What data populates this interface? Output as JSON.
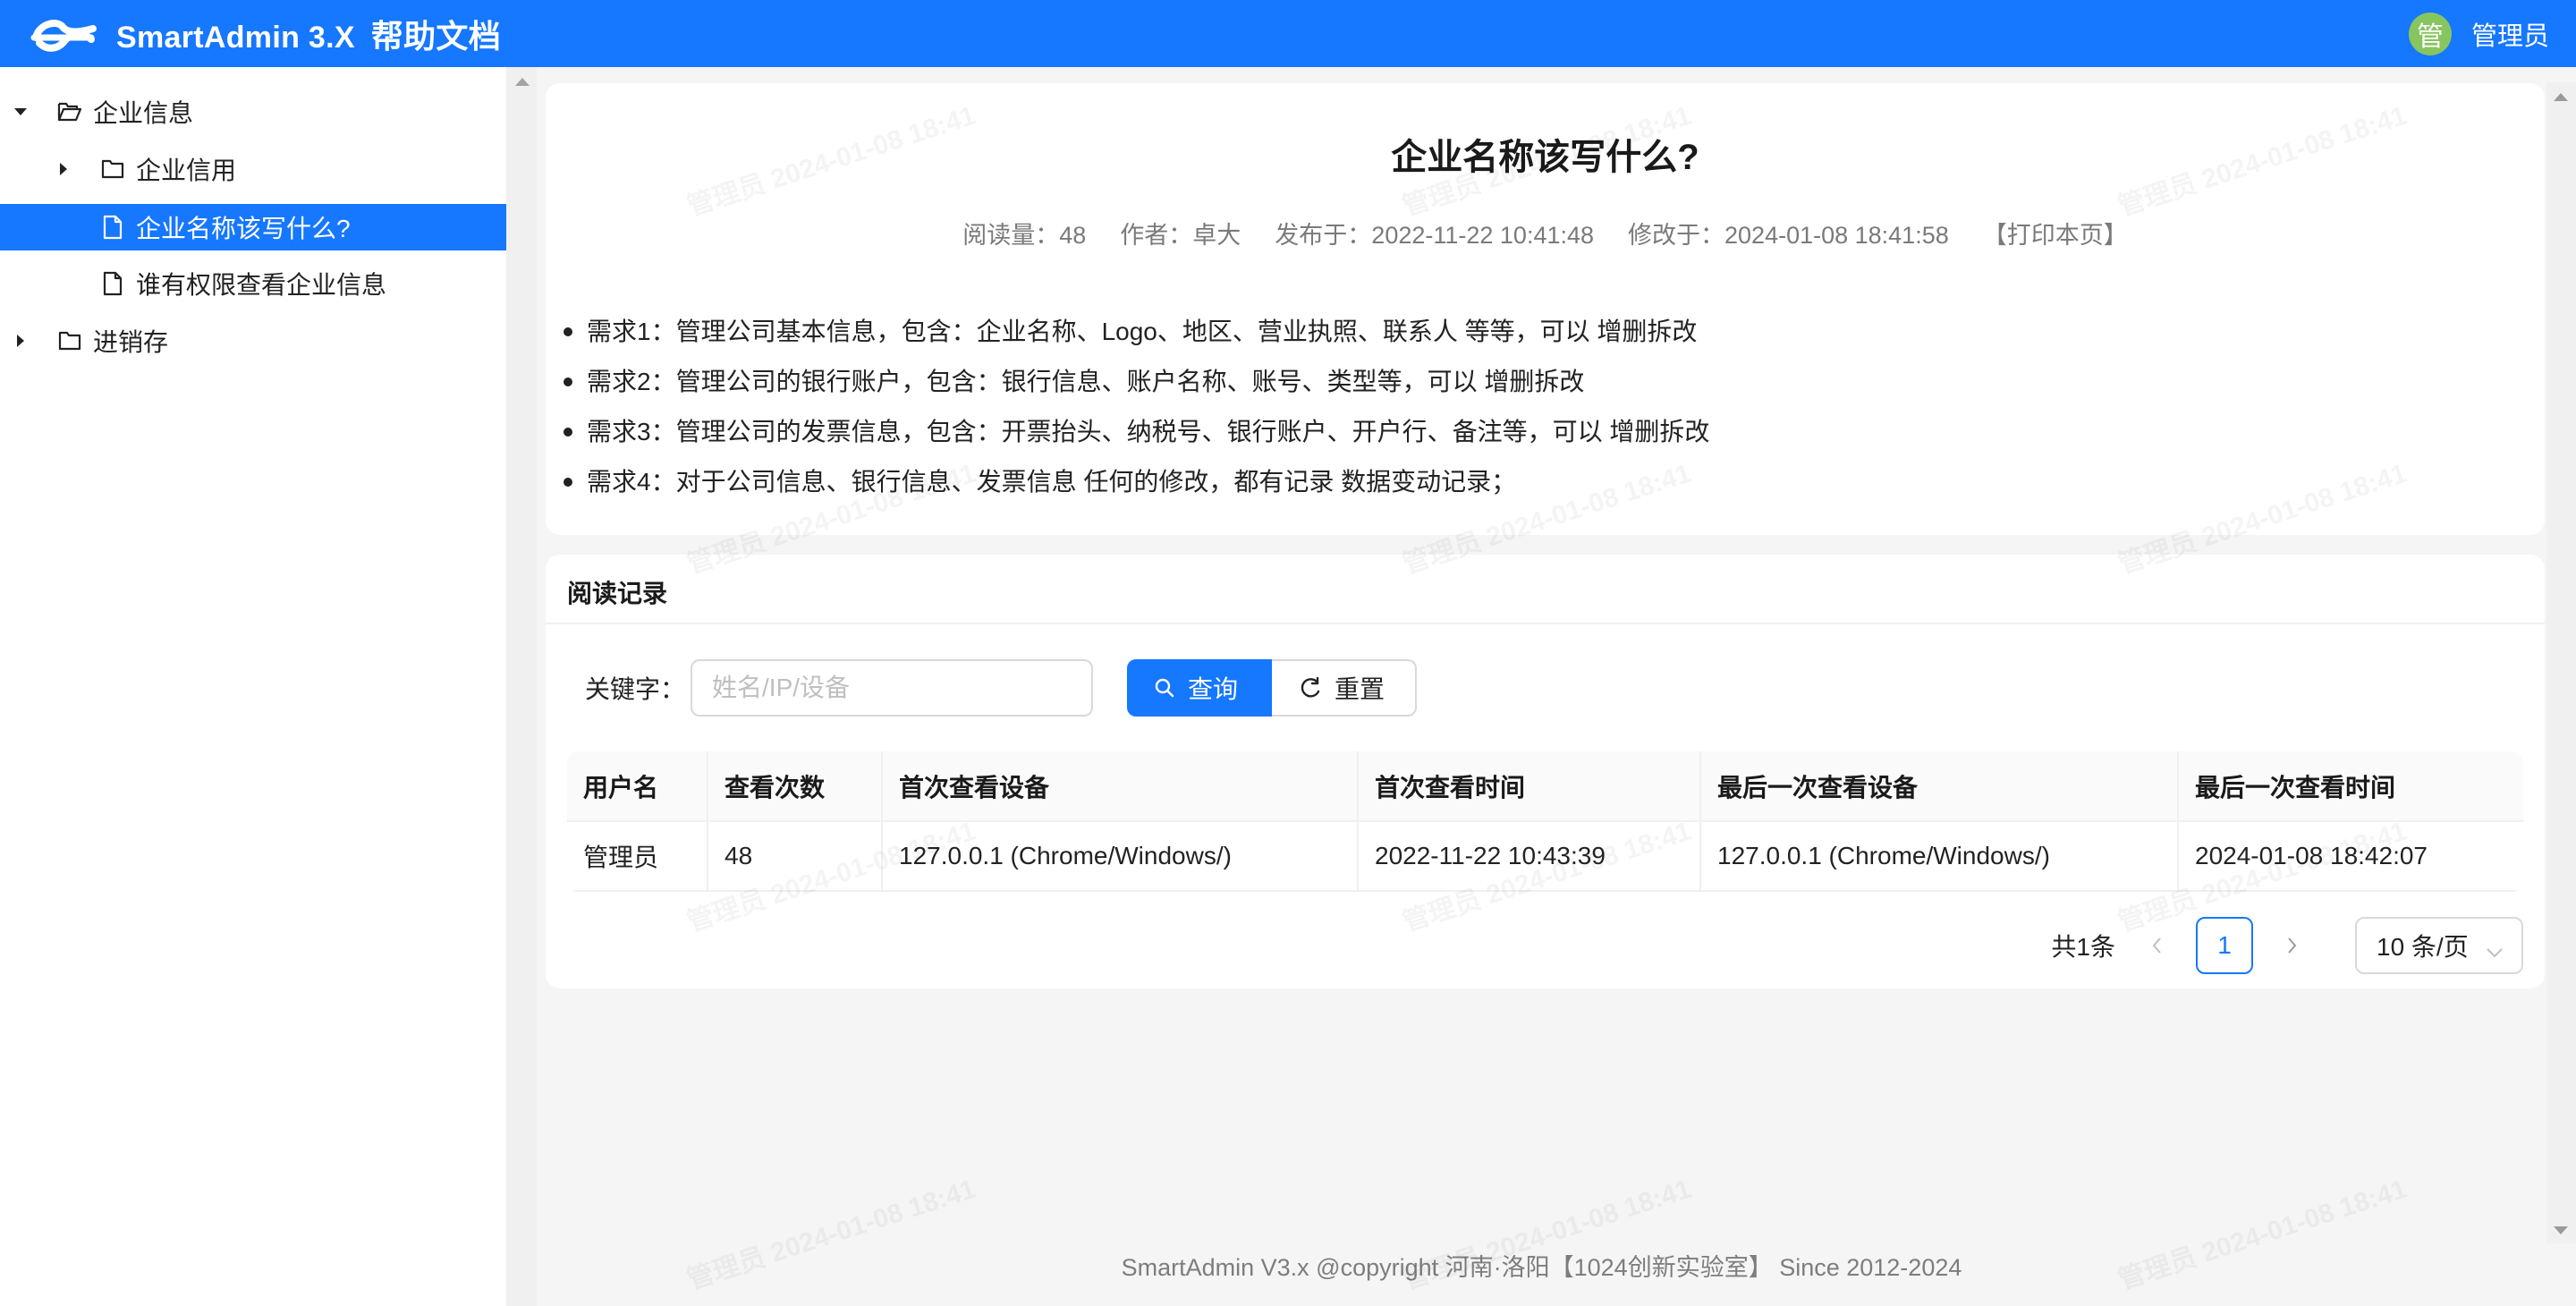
{
  "header": {
    "app_name": "SmartAdmin 3.X",
    "app_subtitle": "帮助文档",
    "avatar_char": "管",
    "user_name": "管理员",
    "brand_color": "#1677ff",
    "avatar_color": "#87c55f"
  },
  "sidebar": {
    "nodes": [
      {
        "label": "企业信息",
        "level": 0,
        "type": "folder",
        "expanded": true,
        "icon": "folder-open-icon"
      },
      {
        "label": "企业信用",
        "level": 1,
        "type": "folder",
        "expanded": false,
        "icon": "folder-icon"
      },
      {
        "label": "企业名称该写什么?",
        "level": 2,
        "type": "file",
        "selected": true,
        "icon": "file-icon"
      },
      {
        "label": "谁有权限查看企业信息",
        "level": 2,
        "type": "file",
        "icon": "file-icon"
      },
      {
        "label": "进销存",
        "level": 0,
        "type": "folder",
        "expanded": false,
        "icon": "folder-icon"
      }
    ]
  },
  "doc": {
    "title": "企业名称该写什么?",
    "meta": {
      "views": "阅读量：48",
      "author": "作者：卓大",
      "published": "发布于：2022-11-22 10:41:48",
      "modified": "修改于：2024-01-08 18:41:58",
      "print": "【打印本页】"
    },
    "items": [
      "需求1：管理公司基本信息，包含：企业名称、Logo、地区、营业执照、联系人 等等，可以 增删拆改",
      "需求2：管理公司的银行账户，包含：银行信息、账户名称、账号、类型等，可以 增删拆改",
      "需求3：管理公司的发票信息，包含：开票抬头、纳税号、银行账户、开户行、备注等，可以 增删拆改",
      "需求4：对于公司信息、银行信息、发票信息 任何的修改，都有记录 数据变动记录；"
    ]
  },
  "records": {
    "title": "阅读记录",
    "search": {
      "label": "关键字：",
      "value": "",
      "placeholder": "姓名/IP/设备",
      "query_label": "查询",
      "reset_label": "重置"
    },
    "columns": [
      "用户名",
      "查看次数",
      "首次查看设备",
      "首次查看时间",
      "最后一次查看设备",
      "最后一次查看时间"
    ],
    "rows": [
      [
        "管理员",
        "48",
        "127.0.0.1 (Chrome/Windows/)",
        "2022-11-22 10:43:39",
        "127.0.0.1 (Chrome/Windows/)",
        "2024-01-08 18:42:07"
      ]
    ],
    "pagination": {
      "total": "共1条",
      "current_page": "1",
      "page_size": "10 条/页"
    }
  },
  "footer": {
    "text": "SmartAdmin V3.x @copyright 河南·洛阳【1024创新实验室】 Since 2012-2024"
  },
  "watermark": {
    "text": "管理员 2024-01-08 18:41"
  }
}
